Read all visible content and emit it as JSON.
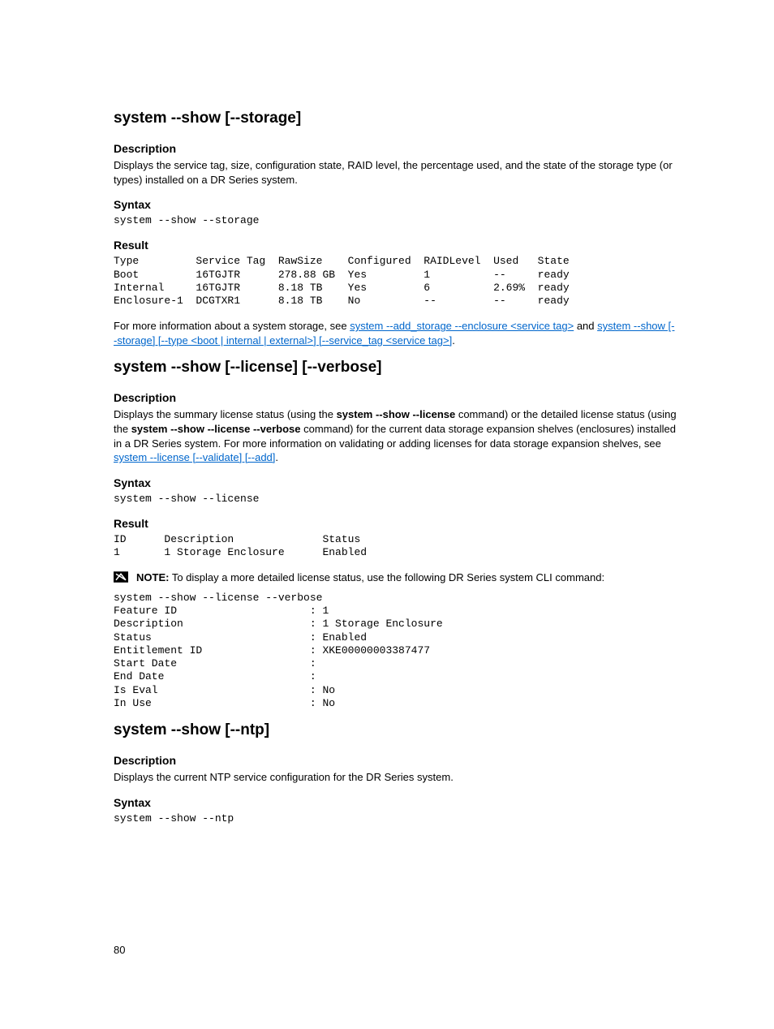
{
  "page_number": "80",
  "sections": {
    "storage": {
      "title": "system --show [--storage]",
      "desc_head": "Description",
      "desc_body": "Displays the service tag, size, configuration state, RAID level, the percentage used, and the state of the storage type (or types) installed on a DR Series system.",
      "syntax_head": "Syntax",
      "syntax_code": "system --show --storage",
      "result_head": "Result",
      "result_code": "Type         Service Tag  RawSize    Configured  RAIDLevel  Used   State\nBoot         16TGJTR      278.88 GB  Yes         1          --     ready\nInternal     16TGJTR      8.18 TB    Yes         6          2.69%  ready\nEnclosure-1  DCGTXR1      8.18 TB    No          --         --     ready",
      "more_pre": "For more information about a system storage, see ",
      "more_link1": "system --add_storage --enclosure <service tag>",
      "more_mid": " and ",
      "more_link2": "system --show [--storage] [--type <boot | internal | external>] [--service_tag <service tag>]",
      "more_end": "."
    },
    "license": {
      "title": "system --show [--license] [--verbose]",
      "desc_head": "Description",
      "desc_pre": "Displays the summary license status (using the ",
      "desc_bold1": "system --show --license",
      "desc_mid1": " command) or the detailed license status (using the ",
      "desc_bold2": "system --show --license --verbose",
      "desc_mid2": " command) for the current data storage expansion shelves (enclosures) installed in a DR Series system. For more information on validating or adding licenses for data storage expansion shelves, see ",
      "desc_link": "system --license [--validate] [--add]",
      "desc_end": ".",
      "syntax_head": "Syntax",
      "syntax_code": "system --show --license",
      "result_head": "Result",
      "result_code": "ID      Description              Status\n1       1 Storage Enclosure      Enabled",
      "note_label": "NOTE:",
      "note_body": " To display a more detailed license status, use the following DR Series system CLI command:",
      "verbose_code": "system --show --license --verbose\nFeature ID                     : 1\nDescription                    : 1 Storage Enclosure\nStatus                         : Enabled\nEntitlement ID                 : XKE00000003387477\nStart Date                     :\nEnd Date                       :\nIs Eval                        : No\nIn Use                         : No"
    },
    "ntp": {
      "title": "system --show [--ntp]",
      "desc_head": "Description",
      "desc_body": "Displays the current NTP service configuration for the DR Series system.",
      "syntax_head": "Syntax",
      "syntax_code": "system --show --ntp"
    }
  }
}
